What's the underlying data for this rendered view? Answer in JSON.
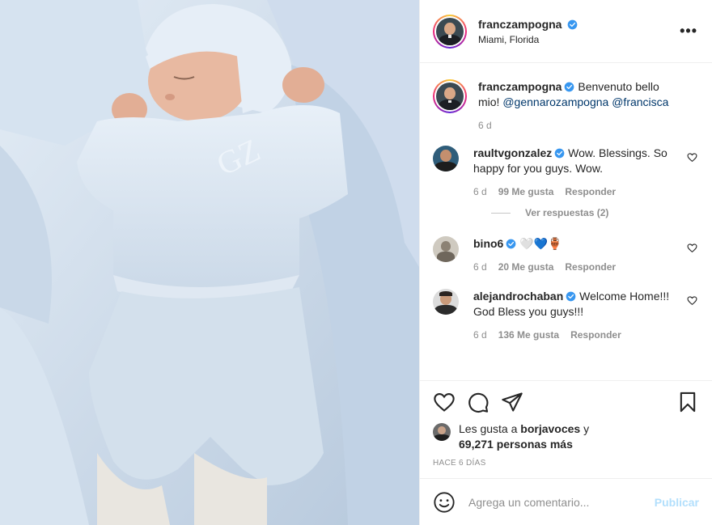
{
  "post": {
    "author": "franczampogna",
    "location": "Miami, Florida",
    "photo_alt": "Newborn baby sleeping in light blue outfit"
  },
  "caption": {
    "username": "franczampogna",
    "text": "Benvenuto bello mio!",
    "mentions": [
      "@gennarozampogna",
      "@francisca"
    ],
    "time": "6 d"
  },
  "comments": [
    {
      "username": "raultvgonzalez",
      "text": "Wow. Blessings. So happy for you guys. Wow.",
      "time": "6 d",
      "likes": "99 Me gusta",
      "reply": "Responder",
      "view_replies": "Ver respuestas (2)"
    },
    {
      "username": "bino6",
      "text": "🤍💙🏺",
      "time": "6 d",
      "likes": "20 Me gusta",
      "reply": "Responder"
    },
    {
      "username": "alejandrochaban",
      "text": "Welcome Home!!! God Bless you guys!!!",
      "time": "6 d",
      "likes": "136 Me gusta",
      "reply": "Responder"
    }
  ],
  "likes": {
    "prefix": "Les gusta a",
    "user": "borjavoces",
    "connector": "y",
    "count": "69,271 personas más"
  },
  "posted_ago": "HACE 6 DÍAS",
  "add_comment": {
    "placeholder": "Agrega un comentario...",
    "publish": "Publicar"
  },
  "icons": {
    "verified": "verified-badge-icon",
    "more": "more-options-icon",
    "like": "heart-icon",
    "comment": "comment-bubble-icon",
    "share": "paper-plane-icon",
    "save": "bookmark-icon",
    "emoji": "smiley-icon"
  },
  "colors": {
    "verified": "#3897f0",
    "link": "#00376b",
    "publish_disabled": "#b2dffc"
  }
}
